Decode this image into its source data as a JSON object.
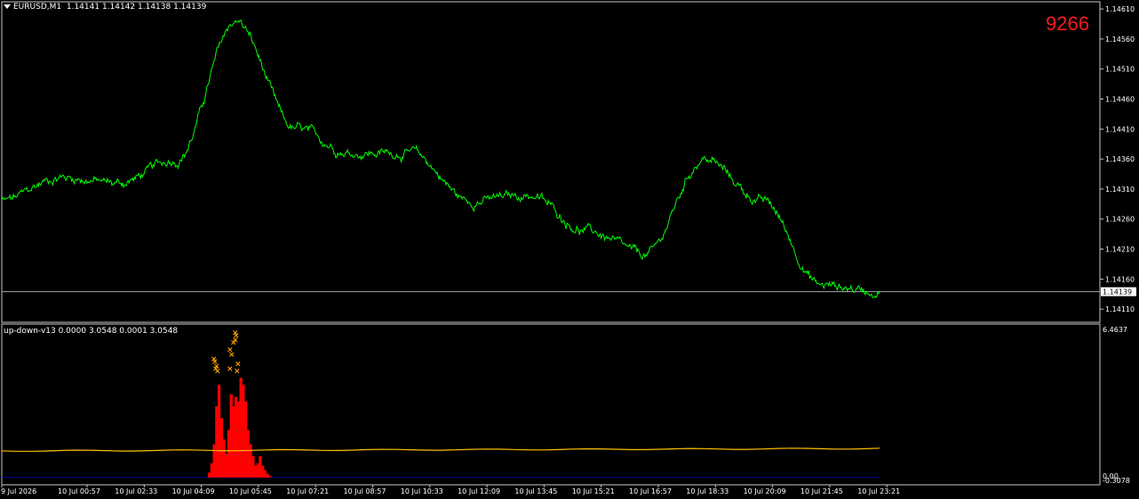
{
  "header": {
    "symbol": "EURUSD,M1",
    "ohlc": "1.14141 1.14142 1.14138 1.14139"
  },
  "bar_counter": "9266",
  "indicator": {
    "label": "up-down-v13 0.0000 3.0548 0.0001 3.0548"
  },
  "colors": {
    "background": "#000000",
    "price_line": "#00ff00",
    "histogram": "#ff0000",
    "signal_line": "#ffc000",
    "markers": "#ffa500",
    "zero_line": "#0000a0",
    "bid_line": "#9a9a9a",
    "counter": "#ff1a1a"
  },
  "chart_data": [
    {
      "type": "line",
      "series": [
        {
          "x": [
            "9 Jul 2026",
            "10 Jul 00:57",
            "10 Jul 02:33",
            "10 Jul 04:09",
            "10 Jul 05:45",
            "10 Jul 07:21",
            "10 Jul 08:57",
            "10 Jul 10:33",
            "10 Jul 12:09",
            "10 Jul 13:45",
            "10 Jul 15:21",
            "10 Jul 16:57",
            "10 Jul 18:33",
            "10 Jul 20:09",
            "10 Jul 21:45",
            "10 Jul 23:21"
          ],
          "values": [
            1.1429,
            1.1433,
            1.1432,
            1.1436,
            1.1459,
            1.1441,
            1.1437,
            1.1437,
            1.1429,
            1.143,
            1.1424,
            1.142,
            1.1436,
            1.1429,
            1.1415,
            1.1414
          ]
        }
      ],
      "x_tick_labels": [
        "9 Jul 2026",
        "10 Jul 00:57",
        "10 Jul 02:33",
        "10 Jul 04:09",
        "10 Jul 05:45",
        "10 Jul 07:21",
        "10 Jul 08:57",
        "10 Jul 10:33",
        "10 Jul 12:09",
        "10 Jul 13:45",
        "10 Jul 15:21",
        "10 Jul 16:57",
        "10 Jul 18:33",
        "10 Jul 20:09",
        "10 Jul 21:45",
        "10 Jul 23:21"
      ],
      "y_tick_labels": [
        "1.14610",
        "1.14560",
        "1.14510",
        "1.14460",
        "1.14410",
        "1.14360",
        "1.14310",
        "1.14260",
        "1.14210",
        "1.14160",
        "1.14110"
      ],
      "ylim": [
        1.14088,
        1.14622
      ],
      "current_price": "1.14139",
      "grid": false
    },
    {
      "type": "bar",
      "series": [
        {
          "values": [
            0.2,
            0.6,
            1.4,
            3.0,
            3.9,
            2.5,
            1.6,
            1.0,
            2.0,
            3.5,
            3.0,
            3.4,
            3.2,
            4.2,
            3.9,
            3.2,
            2.0,
            1.4,
            0.9,
            0.5,
            0.6,
            0.9,
            0.5,
            0.3,
            0.15,
            0.05
          ]
        },
        {
          "values": [
            1.12,
            1.22
          ]
        }
      ],
      "marker_values": [
        6.1,
        6.0,
        5.8,
        5.7,
        5.4,
        5.2,
        5.0,
        4.9,
        4.8,
        4.7,
        4.6,
        4.6,
        4.5,
        4.5
      ],
      "y_tick_labels": [
        "6.4637",
        "0.00",
        "-0.3078"
      ],
      "ylim": [
        -0.3078,
        6.4637
      ],
      "grid": false
    }
  ]
}
